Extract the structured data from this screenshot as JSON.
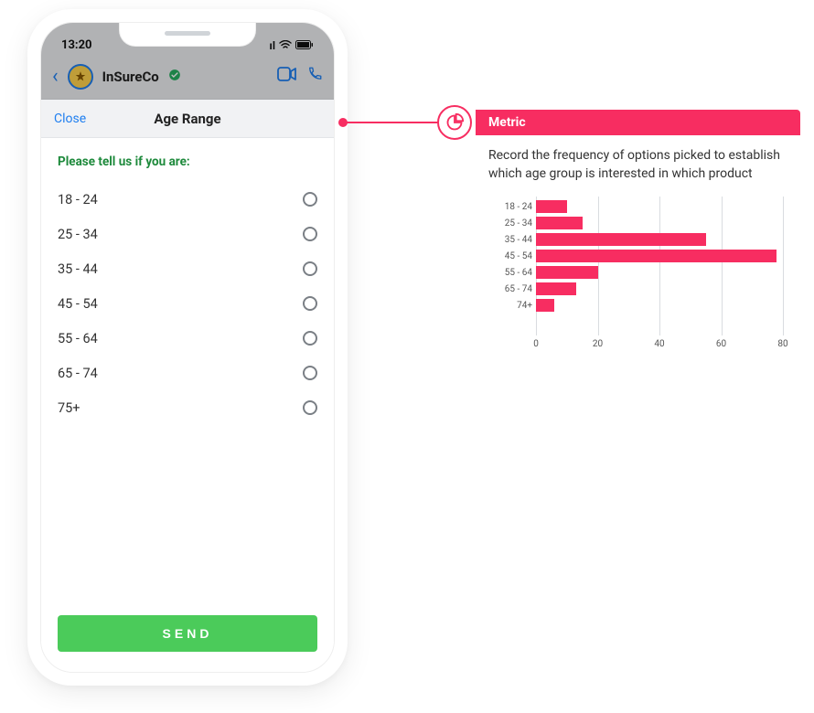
{
  "phone": {
    "status": {
      "time": "13:20",
      "signal": "••ıl",
      "wifi": "▾",
      "battery": "■"
    },
    "nav": {
      "title": "InSureCo",
      "badge_icon": "star-badge-icon",
      "verified_icon": "verified-icon"
    },
    "sheet": {
      "close_label": "Close",
      "title": "Age Range",
      "prompt": "Please tell us if you are:",
      "options": [
        "18 - 24",
        "25 - 34",
        "35 - 44",
        "45 - 54",
        "55 - 64",
        "65 - 74",
        "75+"
      ],
      "send_label": "SEND"
    }
  },
  "annotation": {
    "title": "Metric",
    "description": "Record the frequency of options picked to establish which age group is interested in which product"
  },
  "chart_data": {
    "type": "bar",
    "orientation": "horizontal",
    "categories": [
      "18 - 24",
      "25 - 34",
      "35 - 44",
      "45 - 54",
      "55 - 64",
      "65 - 74",
      "74+"
    ],
    "values": [
      10,
      15,
      55,
      78,
      20,
      13,
      6
    ],
    "xlabel": "",
    "ylabel": "",
    "xlim": [
      0,
      80
    ],
    "x_ticks": [
      0,
      20,
      40,
      60,
      80
    ],
    "color": "#f72d61"
  }
}
